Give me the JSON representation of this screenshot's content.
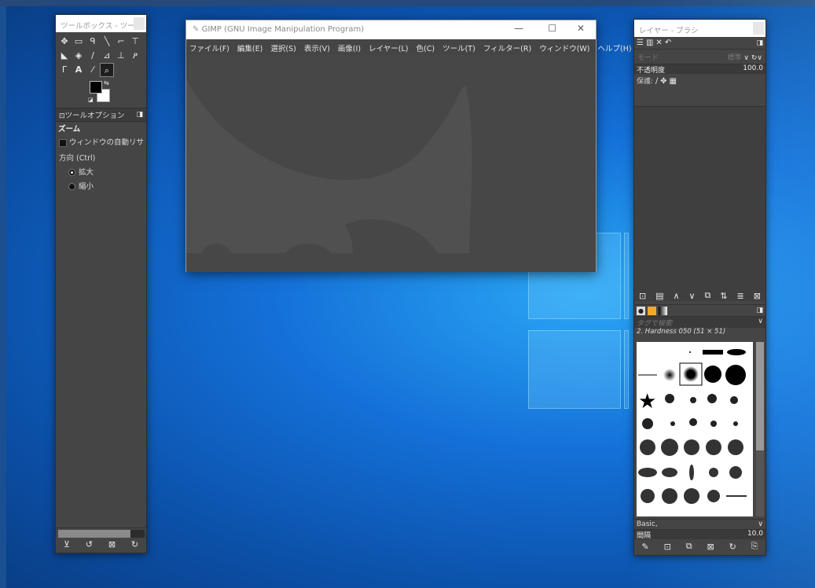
{
  "toolbox": {
    "title": "ツールボックス - ツール...",
    "tool_options_tab": "ツールオプション",
    "zoom_heading": "ズーム",
    "auto_resize_label": "ウィンドウの自動リサ",
    "direction_label": "方向 (Ctrl)",
    "zoom_in_label": "拡大",
    "zoom_out_label": "縮小"
  },
  "main": {
    "title": "GIMP (GNU Image Manipulation Program)",
    "menus": [
      "ファイル(F)",
      "編集(E)",
      "選択(S)",
      "表示(V)",
      "画像(I)",
      "レイヤー(L)",
      "色(C)",
      "ツール(T)",
      "フィルター(R)",
      "ウィンドウ(W)",
      "ヘルプ(H)"
    ]
  },
  "right_dock": {
    "title": "レイヤー - ブラシ",
    "mode_label": "モード",
    "mode_value": "標準",
    "opacity_label": "不透明度",
    "opacity_value": "100.0",
    "lock_label": "保護:",
    "brush_search_placeholder": "タグで検索",
    "brush_name": "2. Hardness 050 (51 × 51)",
    "brush_set": "Basic,",
    "spacing_label": "間隔",
    "spacing_value": "10.0"
  },
  "colors": {
    "panel_bg": "#454545",
    "foreground": "#000000",
    "background": "#ffffff",
    "desktop_accent": "#1470d8"
  }
}
